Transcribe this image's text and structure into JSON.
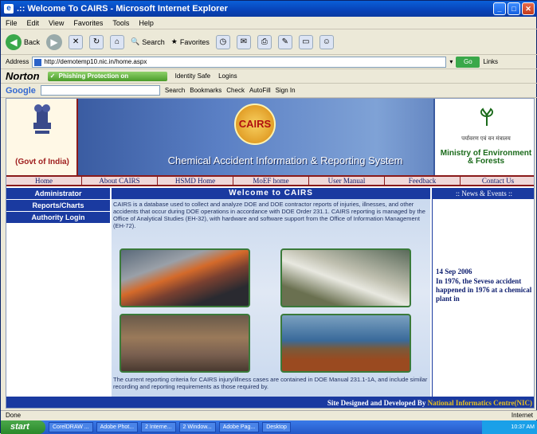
{
  "window": {
    "title": ".:: Welcome To CAIRS - Microsoft Internet Explorer"
  },
  "menubar": [
    "File",
    "Edit",
    "View",
    "Favorites",
    "Tools",
    "Help"
  ],
  "toolbar": {
    "back": "Back",
    "search": "Search",
    "favorites": "Favorites"
  },
  "addressbar": {
    "label": "Address",
    "url": "http://demotemp10.nic.in/home.aspx",
    "go": "Go",
    "links": "Links"
  },
  "norton": {
    "logo": "Norton",
    "phishing": "Phishing Protection on",
    "identity": "Identity Safe",
    "logins": "Logins"
  },
  "google": {
    "logo": "Google",
    "search": "Search",
    "bookmarks": "Bookmarks",
    "check": "Check",
    "autofill": "AutoFill",
    "signin": "Sign In"
  },
  "banner": {
    "govt": "(Govt of India)",
    "cairs_logo": "CAIRS",
    "title": "Chemical Accident Information & Reporting System",
    "moef_hindi": "पर्यावरण एवं वन मंत्रालय",
    "moef_line1": "Ministry of Environment",
    "moef_line2": "& Forests"
  },
  "nav": [
    "Home",
    "About CAIRS",
    "HSMD Home",
    "MoEF home",
    "User Manual",
    "Feedback",
    "Contact Us"
  ],
  "leftmenu": [
    "Administrator",
    "Reports/Charts",
    "Authority Login"
  ],
  "content": {
    "heading": "Welcome to CAIRS",
    "intro": "CAIRS is a database used to collect and analyze DOE and DOE contractor reports of injuries, illnesses, and other accidents that occur during DOE operations in accordance with DOE Order 231.1. CAIRS reporting is managed by the Office of Analytical Studies (EH-32), with hardware and software support from the Office of Information Management (EH-72).",
    "bottom": "The current reporting criteria for CAIRS injury/illness cases are contained in DOE Manual 231.1-1A, and include similar recording and reporting requirements as those required by."
  },
  "news": {
    "title": ":: News & Events ::",
    "date": "14 Sep 2006",
    "body": "In 1976, the Seveso accident happened in 1976 at a chemical plant in"
  },
  "footer": {
    "text": "Site Designed and Developed By",
    "org": "National Informatics Centre(NIC)"
  },
  "statusbar": {
    "left": "Done",
    "right": "Internet"
  },
  "taskbar": {
    "start": "start",
    "tasks": [
      "CorelDRAW ...",
      "Adobe Phot...",
      "2 Interne...",
      "2 Window...",
      "Adobe Pag...",
      "Desktop"
    ],
    "clock": "10:37 AM"
  }
}
